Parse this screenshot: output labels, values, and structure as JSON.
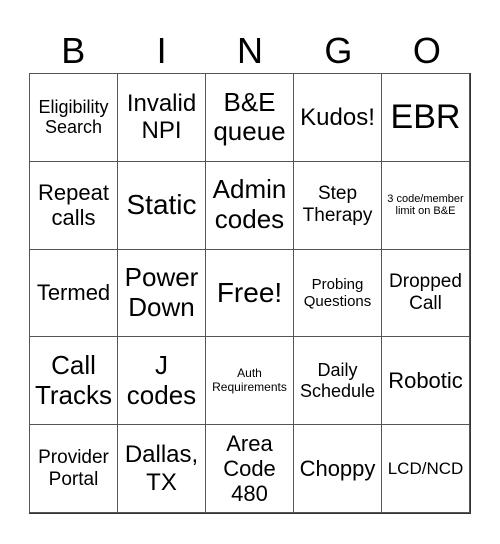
{
  "header": {
    "letters": [
      "B",
      "I",
      "N",
      "G",
      "O"
    ]
  },
  "cells": [
    "Eligibility Search",
    "Invalid NPI",
    "B&E queue",
    "Kudos!",
    "EBR",
    "Repeat calls",
    "Static",
    "Admin codes",
    "Step Therapy",
    "3 code/member limit on B&E",
    "Termed",
    "Power Down",
    "Free!",
    "Probing Questions",
    "Dropped Call",
    "Call Tracks",
    "J codes",
    "Auth Requirements",
    "Daily Schedule",
    "Robotic",
    "Provider Portal",
    "Dallas, TX",
    "Area Code 480",
    "Choppy",
    "LCD/NCD"
  ]
}
